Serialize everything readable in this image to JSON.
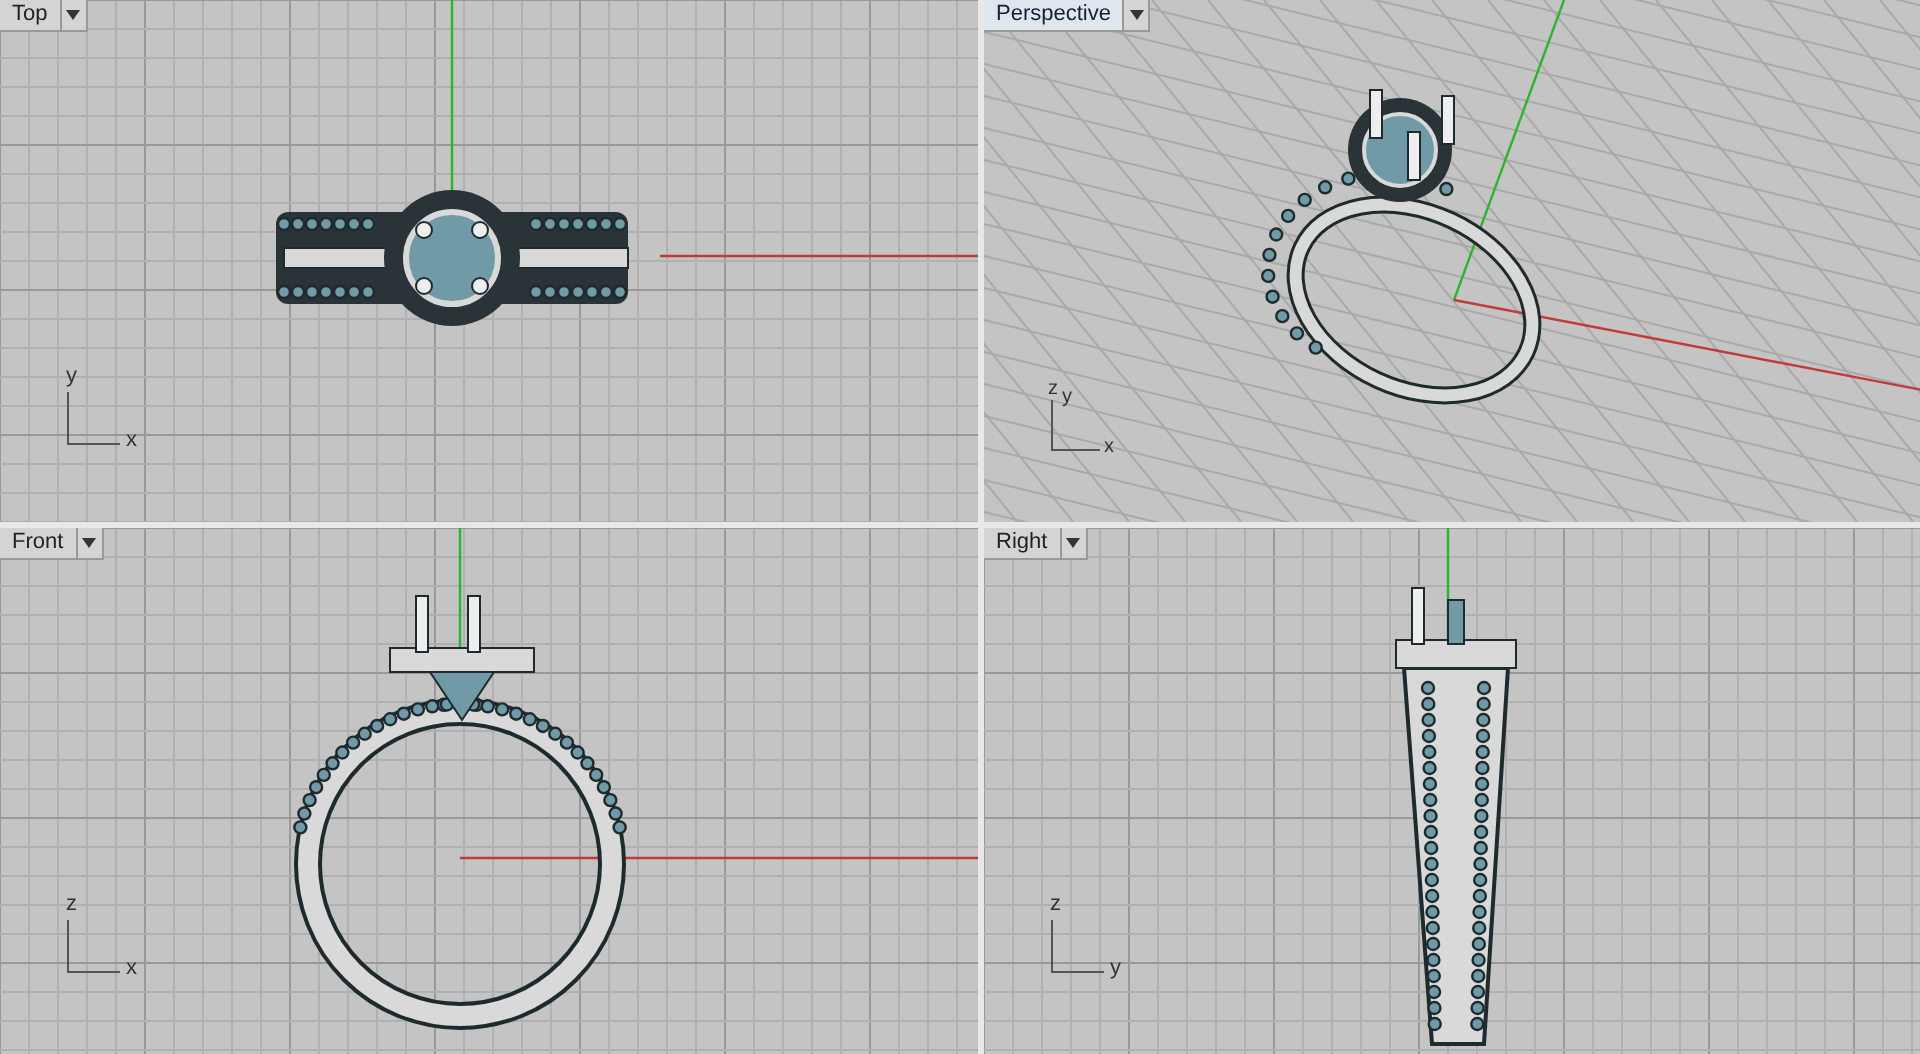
{
  "viewports": [
    {
      "title": "Top",
      "kind": "top",
      "selected": false,
      "axis_labels": [
        "y",
        "x"
      ]
    },
    {
      "title": "Perspective",
      "kind": "perspective",
      "selected": true,
      "axis_labels": [
        "z",
        "y",
        "x"
      ]
    },
    {
      "title": "Front",
      "kind": "front",
      "selected": false,
      "axis_labels": [
        "z",
        "x"
      ]
    },
    {
      "title": "Right",
      "kind": "right",
      "selected": false,
      "axis_labels": [
        "z",
        "y"
      ]
    }
  ]
}
